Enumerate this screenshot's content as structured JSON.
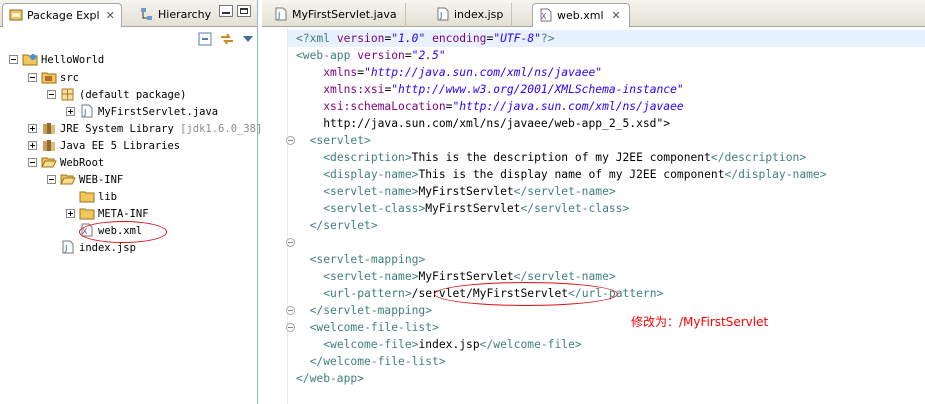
{
  "left_panel": {
    "tabs": [
      {
        "label": "Package Expl",
        "icon": "package-explorer-icon"
      },
      {
        "label": "Hierarchy",
        "icon": "hierarchy-icon"
      }
    ],
    "tree": [
      {
        "label": "HelloWorld",
        "icon": "project-icon",
        "expander": "minus"
      },
      {
        "label": "src",
        "icon": "source-folder-icon",
        "expander": "minus"
      },
      {
        "label": "(default package)",
        "icon": "package-icon",
        "expander": "minus"
      },
      {
        "label": "MyFirstServlet.java",
        "icon": "java-file-icon",
        "expander": "plus"
      },
      {
        "label": "JRE System Library",
        "suffix": "[jdk1.6.0_38]",
        "icon": "library-icon",
        "expander": "plus"
      },
      {
        "label": "Java EE 5 Libraries",
        "icon": "library-icon",
        "expander": "plus"
      },
      {
        "label": "WebRoot",
        "icon": "folder-icon",
        "expander": "minus"
      },
      {
        "label": "WEB-INF",
        "icon": "folder-icon",
        "expander": "minus"
      },
      {
        "label": "lib",
        "icon": "folder-icon",
        "expander": "none"
      },
      {
        "label": "META-INF",
        "icon": "folder-icon",
        "expander": "plus"
      },
      {
        "label": "web.xml",
        "icon": "xml-file-icon",
        "expander": "none"
      },
      {
        "label": "index.jsp",
        "icon": "jsp-file-icon",
        "expander": "none"
      }
    ]
  },
  "editor": {
    "tabs": [
      {
        "label": "MyFirstServlet.java",
        "icon": "java-file-icon"
      },
      {
        "label": "index.jsp",
        "icon": "jsp-file-icon"
      },
      {
        "label": "web.xml",
        "icon": "xml-file-icon",
        "active": true
      }
    ],
    "lines": [
      "<?xml version=\"1.0\" encoding=\"UTF-8\"?>",
      "<web-app version=\"2.5\"",
      "    xmlns=\"http://java.sun.com/xml/ns/javaee\"",
      "    xmlns:xsi=\"http://www.w3.org/2001/XMLSchema-instance\"",
      "    xsi:schemaLocation=\"http://java.sun.com/xml/ns/javaee",
      "    http://java.sun.com/xml/ns/javaee/web-app_2_5.xsd\">",
      "  <servlet>",
      "    <description>This is the description of my J2EE component</description>",
      "    <display-name>This is the display name of my J2EE component</display-name>",
      "    <servlet-name>MyFirstServlet</servlet-name>",
      "    <servlet-class>MyFirstServlet</servlet-class>",
      "  </servlet>",
      "",
      "  <servlet-mapping>",
      "    <servlet-name>MyFirstServlet</servlet-name>",
      "    <url-pattern>/servlet/MyFirstServlet</url-pattern>",
      "  </servlet-mapping>",
      "  <welcome-file-list>",
      "    <welcome-file>index.jsp</welcome-file>",
      "  </welcome-file-list>",
      "</web-app>"
    ],
    "annotation": "修改为：/MyFirstServlet"
  },
  "colors": {
    "tag": "#3f7f7f",
    "attr": "#7f007f",
    "value": "#2a00ff",
    "annotation": "#ff0000"
  }
}
